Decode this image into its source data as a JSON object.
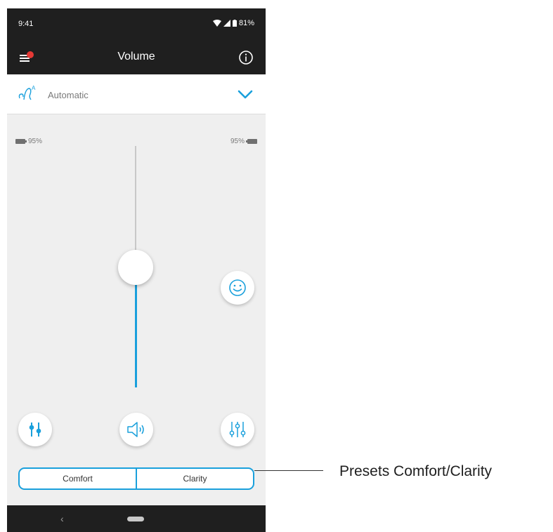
{
  "status_bar": {
    "time": "9:41",
    "battery": "81%"
  },
  "app_bar": {
    "title": "Volume",
    "menu_icon": "hamburger-menu-icon",
    "info_icon": "info-icon"
  },
  "program": {
    "label": "Automatic",
    "icon": "hearing-program-icon",
    "chevron_icon": "chevron-down-icon"
  },
  "battery": {
    "left": "95%",
    "right": "95%"
  },
  "volume_slider": {
    "level_fraction": 0.5,
    "accent": "#1aa0dc"
  },
  "buttons": {
    "soundscape": "smiley-icon",
    "equalizer": "equalizer-icon",
    "speaker": "speaker-icon",
    "mixer": "mixer-icon"
  },
  "presets": {
    "left": "Comfort",
    "right": "Clarity"
  },
  "annotation": {
    "text": "Presets Comfort/Clarity"
  },
  "colors": {
    "accent": "#1aa0dc",
    "dark_bar": "#1f1f1f",
    "badge": "#e53935"
  }
}
